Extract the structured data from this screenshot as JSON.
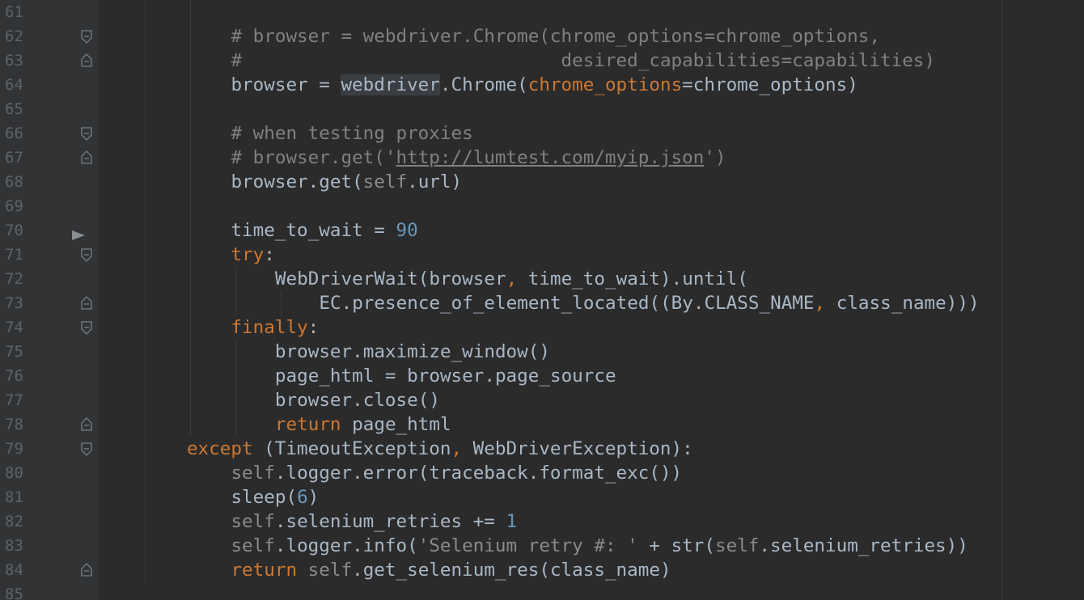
{
  "editor": {
    "colors": {
      "background": "#2b2b2b",
      "gutter": "#313335",
      "keyword": "#cc7832",
      "default": "#a9b7c6",
      "comment": "#808080",
      "number": "#6897bb",
      "line_number": "#606366"
    },
    "lines": [
      {
        "num": "61",
        "indent": 0,
        "fold": "",
        "tokens": []
      },
      {
        "num": "62",
        "indent": 3,
        "fold": "start",
        "tokens": [
          {
            "t": "comment",
            "v": "# browser = webdriver.Chrome(chrome_options=chrome_options,"
          }
        ]
      },
      {
        "num": "63",
        "indent": 3,
        "fold": "end",
        "tokens": [
          {
            "t": "comment",
            "v": "#                             desired_capabilities=capabilities)"
          }
        ]
      },
      {
        "num": "64",
        "indent": 3,
        "fold": "",
        "tokens": [
          {
            "t": "plain",
            "v": "browser = "
          },
          {
            "t": "hl",
            "v": "webdriver"
          },
          {
            "t": "plain",
            "v": ".Chrome("
          },
          {
            "t": "param",
            "v": "chrome_options"
          },
          {
            "t": "plain",
            "v": "=chrome_options)"
          }
        ]
      },
      {
        "num": "65",
        "indent": 0,
        "fold": "",
        "tokens": []
      },
      {
        "num": "66",
        "indent": 3,
        "fold": "start",
        "tokens": [
          {
            "t": "comment",
            "v": "# when testing proxies"
          }
        ]
      },
      {
        "num": "67",
        "indent": 3,
        "fold": "end",
        "tokens": [
          {
            "t": "comment",
            "v": "# browser.get('"
          },
          {
            "t": "url",
            "v": "http://lumtest.com/myip.json"
          },
          {
            "t": "comment",
            "v": "')"
          }
        ]
      },
      {
        "num": "68",
        "indent": 3,
        "fold": "",
        "tokens": [
          {
            "t": "plain",
            "v": "browser.get("
          },
          {
            "t": "self",
            "v": "self"
          },
          {
            "t": "plain",
            "v": ".url)"
          }
        ]
      },
      {
        "num": "69",
        "indent": 0,
        "fold": "",
        "tokens": []
      },
      {
        "num": "70",
        "indent": 3,
        "fold": "",
        "arrow": true,
        "tokens": [
          {
            "t": "plain",
            "v": "time_to_wait = "
          },
          {
            "t": "num",
            "v": "90"
          }
        ]
      },
      {
        "num": "71",
        "indent": 3,
        "fold": "start",
        "tokens": [
          {
            "t": "kw",
            "v": "try"
          },
          {
            "t": "plain",
            "v": ":"
          }
        ]
      },
      {
        "num": "72",
        "indent": 4,
        "fold": "",
        "tokens": [
          {
            "t": "plain",
            "v": "WebDriverWait(browser"
          },
          {
            "t": "kw",
            "v": ","
          },
          {
            "t": "plain",
            "v": " time_to_wait).until("
          }
        ]
      },
      {
        "num": "73",
        "indent": 5,
        "fold": "end",
        "tokens": [
          {
            "t": "plain",
            "v": "EC.presence_of_element_located((By.CLASS_NAME"
          },
          {
            "t": "kw",
            "v": ","
          },
          {
            "t": "plain",
            "v": " class_name)))"
          }
        ]
      },
      {
        "num": "74",
        "indent": 3,
        "fold": "start",
        "tokens": [
          {
            "t": "kw",
            "v": "finally"
          },
          {
            "t": "plain",
            "v": ":"
          }
        ]
      },
      {
        "num": "75",
        "indent": 4,
        "fold": "",
        "tokens": [
          {
            "t": "plain",
            "v": "browser.maximize_window()"
          }
        ]
      },
      {
        "num": "76",
        "indent": 4,
        "fold": "",
        "tokens": [
          {
            "t": "plain",
            "v": "page_html = browser.page_source"
          }
        ]
      },
      {
        "num": "77",
        "indent": 4,
        "fold": "",
        "tokens": [
          {
            "t": "plain",
            "v": "browser.close()"
          }
        ]
      },
      {
        "num": "78",
        "indent": 4,
        "fold": "end",
        "tokens": [
          {
            "t": "kw",
            "v": "return"
          },
          {
            "t": "plain",
            "v": " page_html"
          }
        ]
      },
      {
        "num": "79",
        "indent": 2,
        "fold": "start",
        "tokens": [
          {
            "t": "kw",
            "v": "except"
          },
          {
            "t": "plain",
            "v": " (TimeoutException"
          },
          {
            "t": "kw",
            "v": ","
          },
          {
            "t": "plain",
            "v": " WebDriverException):"
          }
        ]
      },
      {
        "num": "80",
        "indent": 3,
        "fold": "",
        "tokens": [
          {
            "t": "self",
            "v": "self"
          },
          {
            "t": "plain",
            "v": ".logger.error(traceback.format_exc())"
          }
        ]
      },
      {
        "num": "81",
        "indent": 3,
        "fold": "",
        "tokens": [
          {
            "t": "plain",
            "v": "sleep("
          },
          {
            "t": "num",
            "v": "6"
          },
          {
            "t": "plain",
            "v": ")"
          }
        ]
      },
      {
        "num": "82",
        "indent": 3,
        "fold": "",
        "tokens": [
          {
            "t": "self",
            "v": "self"
          },
          {
            "t": "plain",
            "v": ".selenium_retries += "
          },
          {
            "t": "num",
            "v": "1"
          }
        ]
      },
      {
        "num": "83",
        "indent": 3,
        "fold": "",
        "tokens": [
          {
            "t": "self",
            "v": "self"
          },
          {
            "t": "plain",
            "v": ".logger.info("
          },
          {
            "t": "str",
            "v": "'Selenium retry #: '"
          },
          {
            "t": "plain",
            "v": " + str("
          },
          {
            "t": "self",
            "v": "self"
          },
          {
            "t": "plain",
            "v": ".selenium_retries))"
          }
        ]
      },
      {
        "num": "84",
        "indent": 3,
        "fold": "end",
        "tokens": [
          {
            "t": "kw",
            "v": "return"
          },
          {
            "t": "plain",
            "v": " "
          },
          {
            "t": "self",
            "v": "self"
          },
          {
            "t": "plain",
            "v": ".get_selenium_res(class_name)"
          }
        ]
      },
      {
        "num": "85",
        "indent": 0,
        "fold": "",
        "tokens": []
      }
    ]
  }
}
